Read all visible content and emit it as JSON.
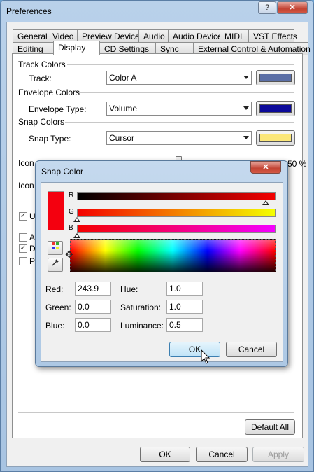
{
  "window": {
    "title": "Preferences",
    "help_label": "?",
    "close_label": "✕"
  },
  "tabs_row1": [
    "General",
    "Video",
    "Preview Device",
    "Audio",
    "Audio Device",
    "MIDI",
    "VST Effects"
  ],
  "tabs_row2": [
    "Editing",
    "Display",
    "CD Settings",
    "Sync",
    "External Control & Automation"
  ],
  "active_tab": "Display",
  "track_colors": {
    "heading": "Track Colors",
    "label": "Track:",
    "value": "Color A",
    "swatch": "#5b6fa6"
  },
  "envelope_colors": {
    "heading": "Envelope Colors",
    "label": "Envelope Type:",
    "value": "Volume",
    "swatch": "#0c0a9a"
  },
  "snap_colors": {
    "heading": "Snap Colors",
    "label": "Snap Type:",
    "value": "Cursor",
    "swatch": "#fbe77a"
  },
  "partial_rows": {
    "icon1": "Icon",
    "icon2": "Icon",
    "pct": "50 %",
    "cb1": "U",
    "cb2": "A",
    "cb3": "D",
    "cb4": "P"
  },
  "default_all_label": "Default All",
  "footer": {
    "ok": "OK",
    "cancel": "Cancel",
    "apply": "Apply"
  },
  "dialog": {
    "title": "Snap Color",
    "close_label": "✕",
    "channels": {
      "r": "R",
      "g": "G",
      "b": "B"
    },
    "current_color": "#f4000f",
    "fields": {
      "red_label": "Red:",
      "red": "243.9",
      "green_label": "Green:",
      "green": "0.0",
      "blue_label": "Blue:",
      "blue": "0.0",
      "hue_label": "Hue:",
      "hue": "1.0",
      "saturation_label": "Saturation:",
      "saturation": "1.0",
      "luminance_label": "Luminance:",
      "luminance": "0.5"
    },
    "ok": "OK",
    "cancel": "Cancel"
  }
}
